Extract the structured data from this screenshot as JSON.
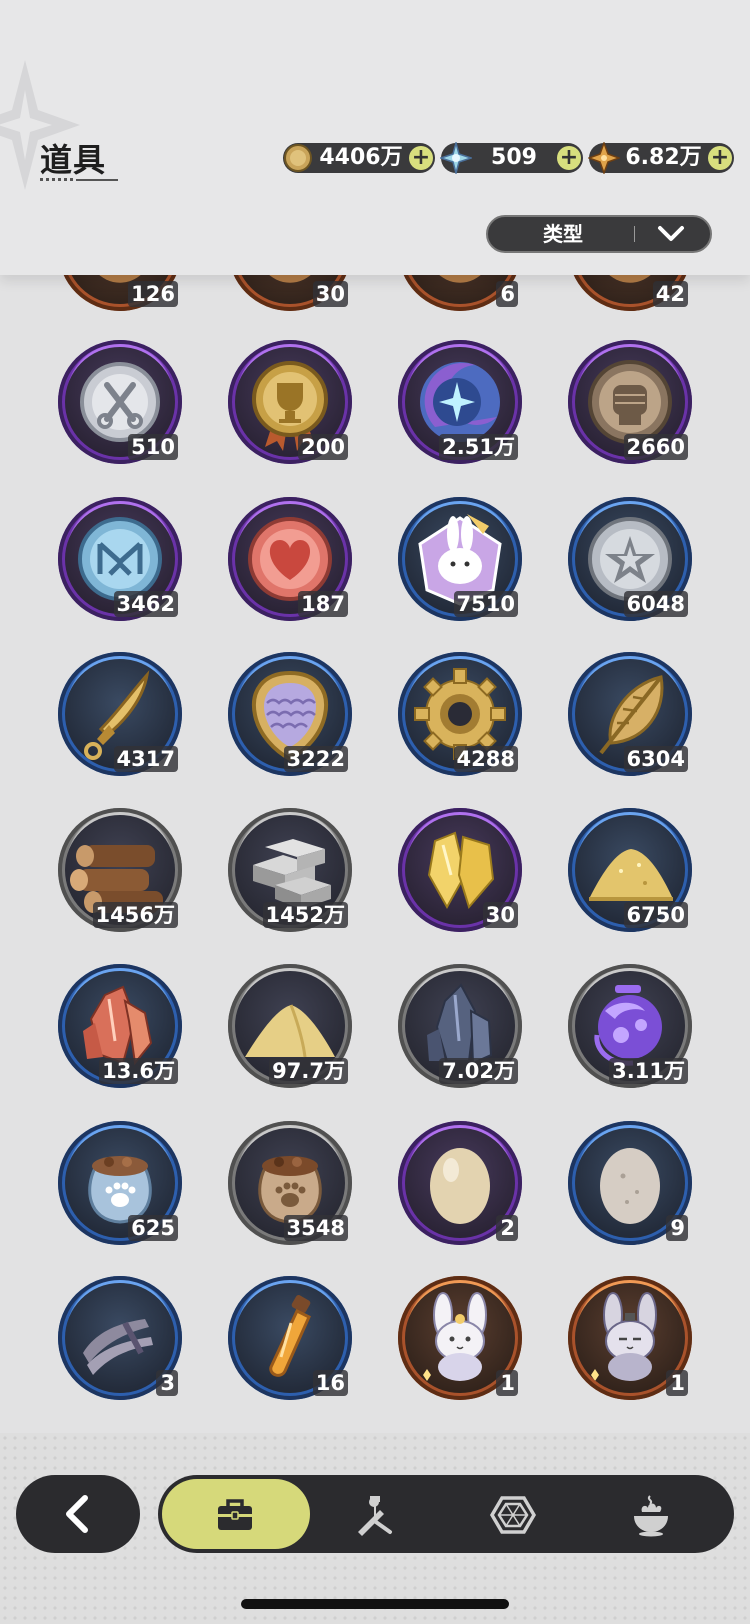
{
  "header": {
    "title": "道具",
    "currencies": [
      {
        "icon": "gold-coin-icon",
        "value": "4406万"
      },
      {
        "icon": "crystal-star-icon",
        "value": "509"
      },
      {
        "icon": "compass-star-icon",
        "value": "6.82万"
      }
    ],
    "filter": {
      "label": "类型"
    }
  },
  "items": [
    {
      "icon": "partial-top-item-icon",
      "count": "126",
      "rarity": "orange"
    },
    {
      "icon": "partial-top-item-icon",
      "count": "30",
      "rarity": "orange"
    },
    {
      "icon": "partial-top-item-icon",
      "count": "6",
      "rarity": "orange"
    },
    {
      "icon": "partial-top-item-icon",
      "count": "42",
      "rarity": "orange"
    },
    {
      "icon": "silver-medal-icon",
      "count": "510",
      "rarity": "purple"
    },
    {
      "icon": "trophy-medal-icon",
      "count": "200",
      "rarity": "purple"
    },
    {
      "icon": "star-moon-icon",
      "count": "2.51万",
      "rarity": "purple"
    },
    {
      "icon": "fist-coin-icon",
      "count": "2660",
      "rarity": "purple"
    },
    {
      "icon": "rune-coin-icon",
      "count": "3462",
      "rarity": "purple"
    },
    {
      "icon": "heart-coin-icon",
      "count": "187",
      "rarity": "purple"
    },
    {
      "icon": "rabbit-badge-icon",
      "count": "7510",
      "rarity": "blue"
    },
    {
      "icon": "star-coin-icon",
      "count": "6048",
      "rarity": "blue"
    },
    {
      "icon": "golden-dagger-icon",
      "count": "4317",
      "rarity": "blue"
    },
    {
      "icon": "scale-shield-icon",
      "count": "3222",
      "rarity": "blue"
    },
    {
      "icon": "gear-icon",
      "count": "4288",
      "rarity": "blue"
    },
    {
      "icon": "golden-leaf-icon",
      "count": "6304",
      "rarity": "blue"
    },
    {
      "icon": "wood-logs-icon",
      "count": "1456万",
      "rarity": "gray"
    },
    {
      "icon": "stone-bricks-icon",
      "count": "1452万",
      "rarity": "gray"
    },
    {
      "icon": "gold-crystal-icon",
      "count": "30",
      "rarity": "purple"
    },
    {
      "icon": "gold-powder-icon",
      "count": "6750",
      "rarity": "blue"
    },
    {
      "icon": "red-crystal-icon",
      "count": "13.6万",
      "rarity": "blue"
    },
    {
      "icon": "sand-pile-icon",
      "count": "97.7万",
      "rarity": "gray"
    },
    {
      "icon": "dark-crystal-icon",
      "count": "7.02万",
      "rarity": "gray"
    },
    {
      "icon": "purple-orb-icon",
      "count": "3.11万",
      "rarity": "gray"
    },
    {
      "icon": "blue-pawprint-sack-icon",
      "count": "625",
      "rarity": "blue"
    },
    {
      "icon": "brown-pawprint-sack-icon",
      "count": "3548",
      "rarity": "gray"
    },
    {
      "icon": "egg-icon",
      "count": "2",
      "rarity": "purple"
    },
    {
      "icon": "gray-egg-icon",
      "count": "9",
      "rarity": "blue"
    },
    {
      "icon": "feather-bundle-icon",
      "count": "3",
      "rarity": "blue"
    },
    {
      "icon": "potion-vial-icon",
      "count": "16",
      "rarity": "blue"
    },
    {
      "icon": "bunny-plush-white-icon",
      "count": "1",
      "rarity": "orange"
    },
    {
      "icon": "bunny-plush-gray-icon",
      "count": "1",
      "rarity": "orange"
    }
  ],
  "nav": {
    "back": "back-arrow-icon",
    "tabs": [
      {
        "icon": "briefcase-icon",
        "active": true
      },
      {
        "icon": "chef-sword-icon",
        "active": false
      },
      {
        "icon": "hexagon-gem-icon",
        "active": false
      },
      {
        "icon": "dish-icon",
        "active": false
      }
    ]
  }
}
